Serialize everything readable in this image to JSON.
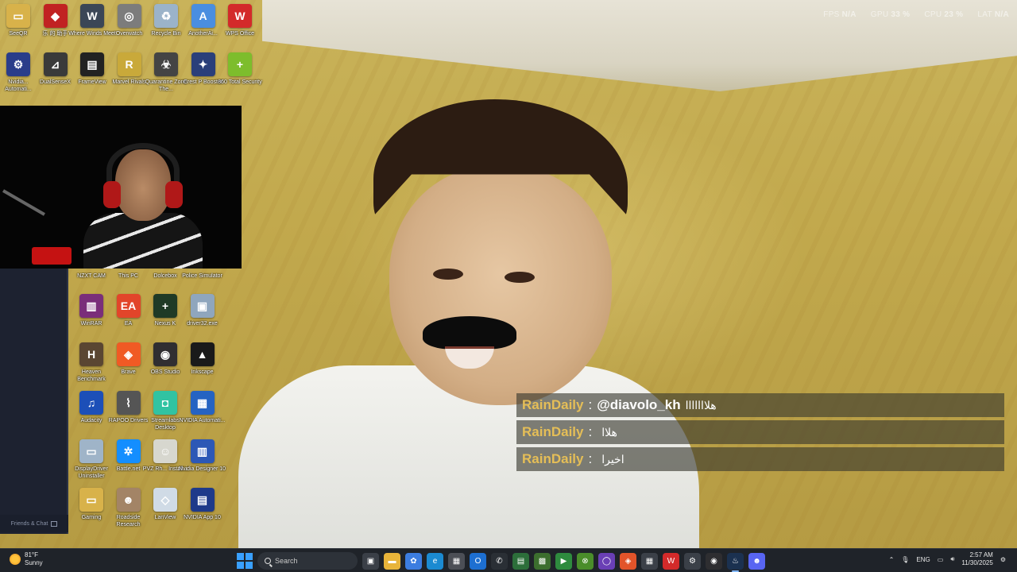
{
  "perf_overlay": {
    "fps_label": "FPS",
    "fps_value": "N/A",
    "gpu_label": "GPU",
    "gpu_value": "33 %",
    "cpu_label": "CPU",
    "cpu_value": "23 %",
    "lat_label": "LAT",
    "lat_value": "N/A"
  },
  "desktop_icons": {
    "row1": [
      {
        "label": "SeeQR",
        "glyph": "▭",
        "color": "#d8b24a"
      },
      {
        "label": "乐 的 助手",
        "glyph": "◆",
        "color": "#c12222"
      },
      {
        "label": "Where Winds Meet",
        "glyph": "W",
        "color": "#3b4656"
      },
      {
        "label": "Overwatch",
        "glyph": "◎",
        "color": "#7c7c7c"
      },
      {
        "label": "Recycle Bin",
        "glyph": "♻",
        "color": "#9bb3c9"
      },
      {
        "label": "AnotherAi...",
        "glyph": "A",
        "color": "#4a8ee0"
      },
      {
        "label": "WPS Office",
        "glyph": "W",
        "color": "#d32a2a"
      }
    ],
    "row2": [
      {
        "label": "Nvidia... Automati...",
        "glyph": "⚙",
        "color": "#2a3d8a"
      },
      {
        "label": "DualSenseX",
        "glyph": "⊿",
        "color": "#3a3a3a"
      },
      {
        "label": "FrameView",
        "glyph": "▤",
        "color": "#222222"
      },
      {
        "label": "Marvel Rivals",
        "glyph": "R",
        "color": "#c9a93a"
      },
      {
        "label": "Quarantine Zone The...",
        "glyph": "☣",
        "color": "#444444"
      },
      {
        "label": "Crest P Booster",
        "glyph": "✦",
        "color": "#2a3f7a"
      },
      {
        "label": "360 Total Security",
        "glyph": "+",
        "color": "#7dbd2c"
      }
    ],
    "grid": [
      {
        "label": "NZXT CAM",
        "glyph": "",
        "color": "transparent"
      },
      {
        "label": "This PC",
        "glyph": "",
        "color": "transparent"
      },
      {
        "label": "Dolcebox",
        "glyph": "",
        "color": "transparent"
      },
      {
        "label": "Police Simulator",
        "glyph": "",
        "color": "transparent"
      },
      {
        "label": "WinRAR",
        "glyph": "▥",
        "color": "#7a2e7a"
      },
      {
        "label": "EA",
        "glyph": "EA",
        "color": "#e2452a"
      },
      {
        "label": "Nexus K",
        "glyph": "+",
        "color": "#1f3a26"
      },
      {
        "label": "driver32.exe",
        "glyph": "▣",
        "color": "#8fa6bd"
      },
      {
        "label": "Heaven Benchmark",
        "glyph": "H",
        "color": "#5a4632"
      },
      {
        "label": "Brave",
        "glyph": "◈",
        "color": "#f05a24"
      },
      {
        "label": "OBS Studio",
        "glyph": "◉",
        "color": "#302e31"
      },
      {
        "label": "Inkscape",
        "glyph": "▲",
        "color": "#1a1a1a"
      },
      {
        "label": "Audacity",
        "glyph": "♫",
        "color": "#1c4fb8"
      },
      {
        "label": "RAPOO Drivers",
        "glyph": "⌇",
        "color": "#555555"
      },
      {
        "label": "Streamlabs Desktop",
        "glyph": "◘",
        "color": "#31c3a2"
      },
      {
        "label": "NVIDIA Automati...",
        "glyph": "▦",
        "color": "#2563c2"
      },
      {
        "label": "DisplayDriver Uninstaller",
        "glyph": "▭",
        "color": "#9fb4c8"
      },
      {
        "label": "Battle.net",
        "glyph": "✲",
        "color": "#148eff"
      },
      {
        "label": "PVZ Rh... Install...",
        "glyph": "☺",
        "color": "#d7d7cf"
      },
      {
        "label": "Nvidia Designer 10",
        "glyph": "▥",
        "color": "#2c58b6"
      },
      {
        "label": "Gaming",
        "glyph": "▭",
        "color": "#d8b24a"
      },
      {
        "label": "Roadside Research",
        "glyph": "☻",
        "color": "#a38466"
      },
      {
        "label": "LanView",
        "glyph": "◇",
        "color": "#d0dbe6"
      },
      {
        "label": "NVIDIA App 10",
        "glyph": "▤",
        "color": "#1e3a8a"
      }
    ]
  },
  "sidebar": {
    "friends_label": "Friends & Chat"
  },
  "chat": {
    "messages": [
      {
        "user": "RainDaily",
        "sep": ":",
        "mention": "@diavolo_kh",
        "text": "هلااااااا"
      },
      {
        "user": "RainDaily",
        "sep": ":",
        "mention": "",
        "text": "هلاا"
      },
      {
        "user": "RainDaily",
        "sep": ":",
        "mention": "",
        "text": "اخيرا"
      }
    ]
  },
  "taskbar": {
    "weather_temp": "81°F",
    "weather_desc": "Sunny",
    "search_placeholder": "Search",
    "apps": [
      {
        "name": "task-view",
        "glyph": "▣",
        "color": "#3a3f47"
      },
      {
        "name": "file-explorer",
        "glyph": "▬",
        "color": "#e8b43a"
      },
      {
        "name": "copilot",
        "glyph": "✿",
        "color": "#3c7de0"
      },
      {
        "name": "edge",
        "glyph": "e",
        "color": "#1b8ad1"
      },
      {
        "name": "store",
        "glyph": "▦",
        "color": "#4c4f56"
      },
      {
        "name": "outlook",
        "glyph": "O",
        "color": "#1d6fd1"
      },
      {
        "name": "whatsapp",
        "glyph": "✆",
        "color": "#2a2f35"
      },
      {
        "name": "media-app",
        "glyph": "▤",
        "color": "#2c6e3a"
      },
      {
        "name": "photos",
        "glyph": "▩",
        "color": "#3c6e2e"
      },
      {
        "name": "play",
        "glyph": "▶",
        "color": "#2e8b3e"
      },
      {
        "name": "xbox",
        "glyph": "⊗",
        "color": "#4a8d2a"
      },
      {
        "name": "cortana",
        "glyph": "◯",
        "color": "#6a3fb5"
      },
      {
        "name": "brave",
        "glyph": "◈",
        "color": "#e2542a"
      },
      {
        "name": "apps-grid",
        "glyph": "▦",
        "color": "#3b4048"
      },
      {
        "name": "wps",
        "glyph": "W",
        "color": "#d32a2a"
      },
      {
        "name": "settings",
        "glyph": "⚙",
        "color": "#3b4048"
      },
      {
        "name": "obs",
        "glyph": "◉",
        "color": "#2e2e31"
      },
      {
        "name": "steam",
        "glyph": "♨",
        "color": "#1b3150"
      },
      {
        "name": "discord",
        "glyph": "☻",
        "color": "#5865f2"
      }
    ],
    "lang": "ENG",
    "time": "2:57 AM",
    "date": "11/30/2025"
  }
}
